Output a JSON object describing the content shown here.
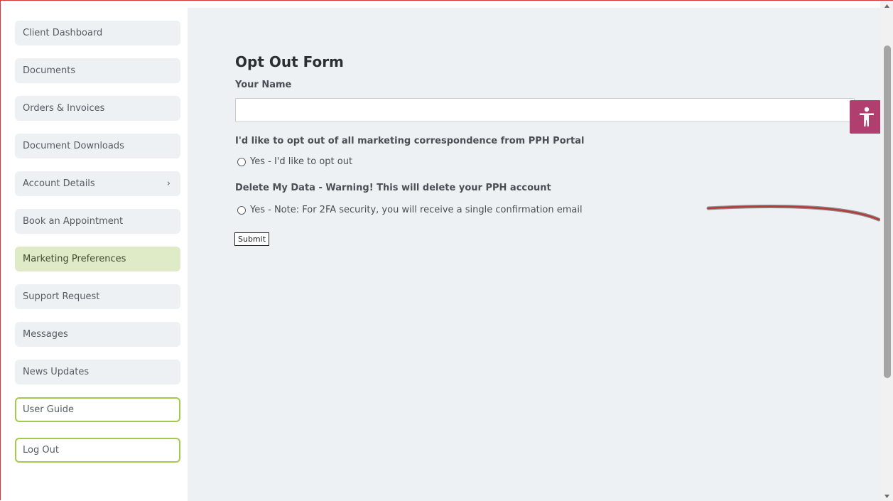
{
  "sidebar": {
    "items": [
      {
        "label": "Client Dashboard"
      },
      {
        "label": "Documents"
      },
      {
        "label": "Orders & Invoices"
      },
      {
        "label": "Document Downloads"
      },
      {
        "label": "Account Details"
      },
      {
        "label": "Book an Appointment"
      },
      {
        "label": "Marketing Preferences"
      },
      {
        "label": "Support Request"
      },
      {
        "label": "Messages"
      },
      {
        "label": "News Updates"
      },
      {
        "label": "User Guide"
      },
      {
        "label": "Log Out"
      }
    ],
    "account_details_chevron": "›",
    "active_item": "Marketing Preferences",
    "active_color": "#dfeac6",
    "outline_color": "#a3c94e"
  },
  "form": {
    "title": "Opt Out Form",
    "name_label": "Your Name",
    "name_value": "",
    "marketing_question": "I'd like to opt out of all marketing correspondence from PPH Portal",
    "marketing_option": "Yes - I'd like to opt out",
    "delete_question": "Delete My Data - Warning! This will delete your PPH account",
    "delete_option": "Yes - Note: For 2FA security, you will receive a single confirmation email",
    "submit_label": "Submit"
  },
  "accessibility": {
    "icon": "accessibility-icon",
    "color": "#b03f6f"
  },
  "colors": {
    "frame_border": "#d23a3a",
    "main_background": "#eef1f3"
  }
}
